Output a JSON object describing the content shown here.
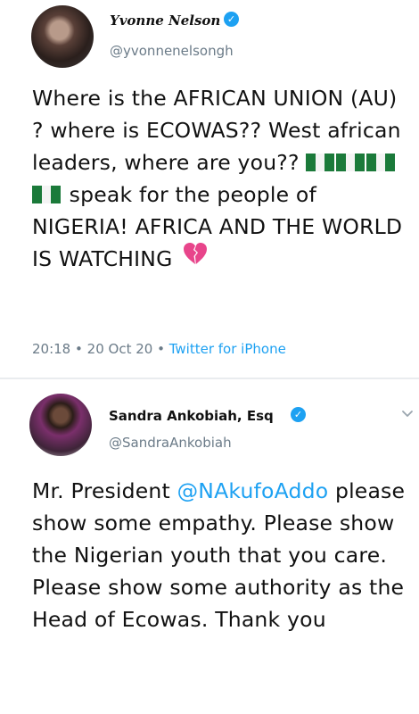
{
  "tweets": [
    {
      "display_name": "Yvonne Nelson",
      "handle": "@yvonnenelsongh",
      "text_part1": "Where is the AFRICAN UNION (AU) ? where is ECOWAS?? West african leaders, where are you?? ",
      "text_part2": " speak for the people of NIGERIA! AFRICA AND THE WORLD IS WATCHING ",
      "flag_count": 4,
      "time": "20:18",
      "date": "20 Oct 20",
      "separator": "•",
      "source": "Twitter for iPhone"
    },
    {
      "display_name": "Sandra Ankobiah, Esq",
      "handle": "@SandraAnkobiah",
      "text_before_mention": "Mr. President ",
      "mention": "@NAkufoAddo",
      "text_after_mention": " please show some empathy. Please show the Nigerian youth that you care. Please show some authority as the Head of Ecowas. Thank you"
    }
  ],
  "colors": {
    "link": "#1da1f2",
    "secondary_text": "#6b7b88",
    "verified": "#1da1f2",
    "heart": "#e8458b"
  },
  "icons": {
    "verified": "verified-badge-icon",
    "chevron": "chevron-down-icon",
    "flag": "nigeria-flag-icon",
    "heart": "broken-heart-icon"
  }
}
